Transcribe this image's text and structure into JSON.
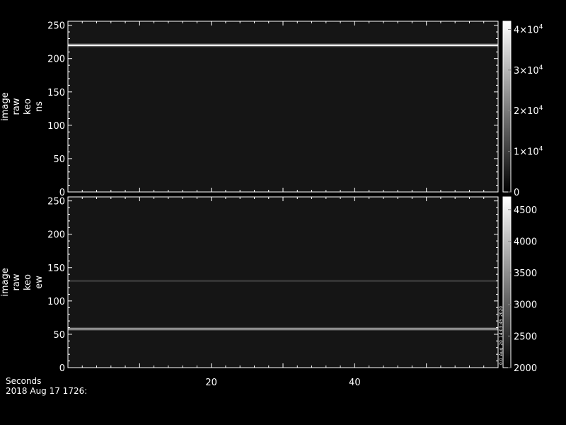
{
  "chart_data": [
    {
      "type": "heatmap",
      "name": "ns",
      "ylabel": [
        "image",
        "raw",
        "keo",
        "ns"
      ],
      "ylim": [
        0,
        256
      ],
      "yticks": [
        0,
        50,
        100,
        150,
        200,
        250
      ],
      "xlim": [
        0,
        60
      ],
      "colorbar": {
        "range": [
          0,
          42000
        ],
        "ticks": [
          {
            "value": 0,
            "label": "0"
          },
          {
            "value": 10000,
            "label": "1×10",
            "exp": "4"
          },
          {
            "value": 20000,
            "label": "2×10",
            "exp": "4"
          },
          {
            "value": 30000,
            "label": "3×10",
            "exp": "4"
          },
          {
            "value": 40000,
            "label": "4×10",
            "exp": "4"
          }
        ]
      },
      "background_level": 1500,
      "bands": [
        {
          "y": 220,
          "intensity": 42000
        }
      ]
    },
    {
      "type": "heatmap",
      "name": "ew",
      "ylabel": [
        "image",
        "raw",
        "keo",
        "ew"
      ],
      "ylim": [
        0,
        256
      ],
      "yticks": [
        0,
        50,
        100,
        150,
        200,
        250
      ],
      "xlim": [
        0,
        60
      ],
      "colorbar": {
        "range": [
          2000,
          4700
        ],
        "ticks": [
          {
            "value": 2000,
            "label": "2000"
          },
          {
            "value": 2500,
            "label": "2500"
          },
          {
            "value": 3000,
            "label": "3000"
          },
          {
            "value": 3500,
            "label": "3500"
          },
          {
            "value": 4000,
            "label": "4000"
          },
          {
            "value": 4500,
            "label": "4500"
          }
        ],
        "side_text": "0.0_Aug_20_14:03:45_2020"
      },
      "background_level": 2100,
      "bands": [
        {
          "y": 58,
          "intensity": 3900
        },
        {
          "y": 130,
          "intensity": 2700
        }
      ]
    }
  ],
  "xaxis": {
    "label": "Seconds",
    "ticks": [
      20,
      40
    ],
    "footer": "2018 Aug 17 1726:"
  }
}
